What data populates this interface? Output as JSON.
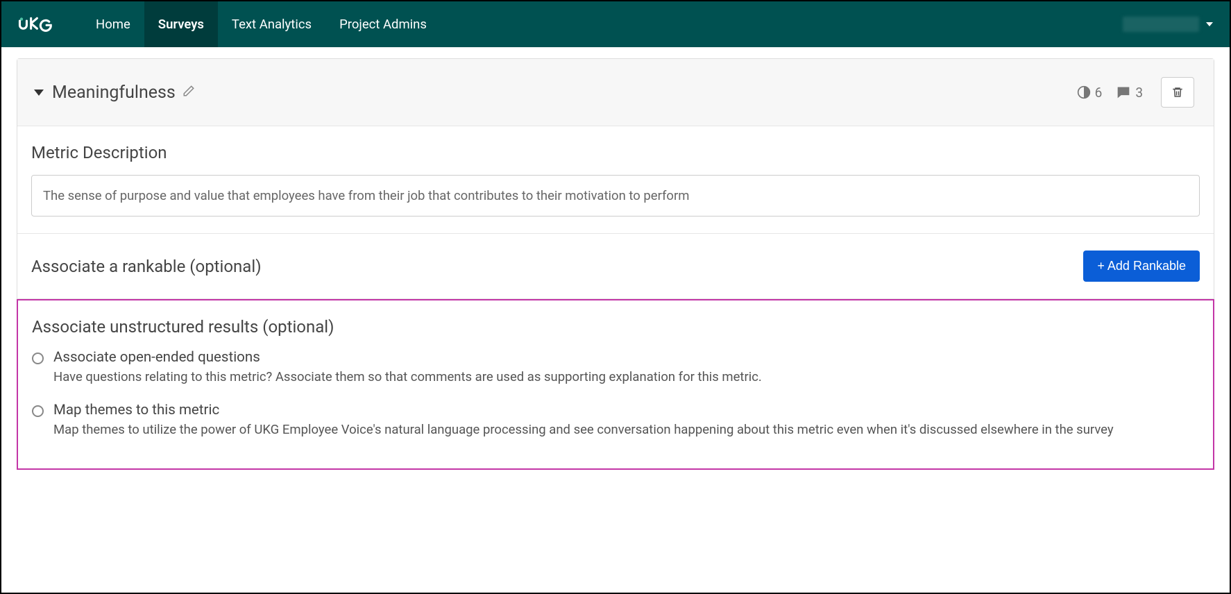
{
  "nav": {
    "logo": "UKG",
    "items": [
      {
        "label": "Home",
        "active": false
      },
      {
        "label": "Surveys",
        "active": true
      },
      {
        "label": "Text Analytics",
        "active": false
      },
      {
        "label": "Project Admins",
        "active": false
      }
    ]
  },
  "panel": {
    "title": "Meaningfulness",
    "stat_contrast": "6",
    "stat_comments": "3"
  },
  "metric_description": {
    "title": "Metric Description",
    "value": "The sense of purpose and value that employees have from their job that contributes to their motivation to perform"
  },
  "rankable": {
    "title": "Associate a rankable (optional)",
    "button": "+ Add Rankable"
  },
  "unstructured": {
    "title": "Associate unstructured results (optional)",
    "options": [
      {
        "label": "Associate open-ended questions",
        "desc": "Have questions relating to this metric? Associate them so that comments are used as supporting explanation for this metric."
      },
      {
        "label": "Map themes to this metric",
        "desc": "Map themes to utilize the power of UKG Employee Voice's natural language processing and see conversation happening about this metric even when it's discussed elsewhere in the survey"
      }
    ]
  }
}
